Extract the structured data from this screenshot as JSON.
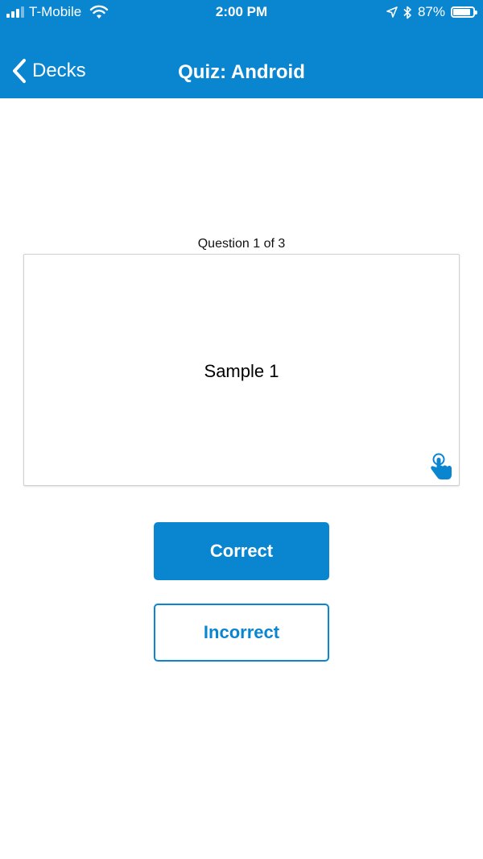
{
  "status_bar": {
    "carrier": "T-Mobile",
    "time": "2:00 PM",
    "battery": "87%",
    "battery_level": 0.87,
    "icons": [
      "signal-icon",
      "wifi-icon",
      "location-arrow-icon",
      "bluetooth-icon",
      "battery-icon"
    ]
  },
  "nav": {
    "back_label": "Decks",
    "title": "Quiz: Android"
  },
  "quiz": {
    "counter": "Question 1 of 3",
    "card_text": "Sample 1",
    "correct_label": "Correct",
    "incorrect_label": "Incorrect"
  },
  "colors": {
    "accent": "#0a85d0",
    "background": "#ffffff",
    "card_border": "#d0d0d0"
  }
}
